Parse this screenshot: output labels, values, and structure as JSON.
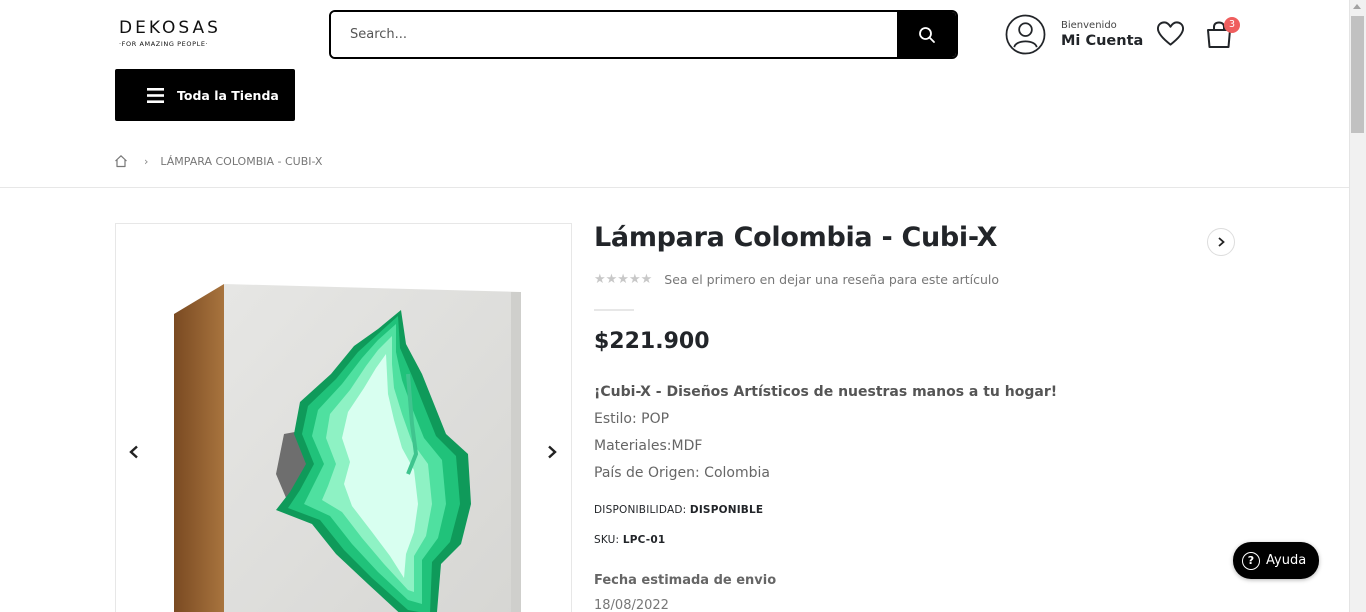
{
  "header": {
    "logo_main": "DEKOSAS",
    "logo_sub": "·FOR AMAZING PEOPLE·",
    "search_placeholder": "Search...",
    "account_greeting": "Bienvenido",
    "account_label": "Mi Cuenta",
    "cart_count": "3",
    "store_button": "Toda la Tienda"
  },
  "breadcrumb": {
    "current": "LÁMPARA COLOMBIA - CUBI-X"
  },
  "product": {
    "title": "Lámpara Colombia - Cubi-X",
    "rating_text": "Sea el primero en dejar una reseña para este artículo",
    "rating_stars": "★★★★★",
    "price": "$221.900",
    "description_headline": "¡Cubi-X - Diseños Artísticos de nuestras manos a tu hogar!",
    "style_line": "Estilo: POP",
    "materials_line": "Materiales:MDF",
    "origin_line": "País de Origen: Colombia",
    "availability_label": "DISPONIBILIDAD:",
    "availability_value": "DISPONIBLE",
    "sku_label": "SKU:",
    "sku_value": "LPC-01",
    "ship_label": "Fecha estimada de envio",
    "ship_date": "18/08/2022"
  },
  "help": {
    "label": "Ayuda"
  },
  "colors": {
    "accent": "#000000",
    "badge": "#ef5e5e",
    "text_dark": "#222529",
    "text_muted": "#777777"
  },
  "icons": {
    "search": "search-icon",
    "account": "user-circle-icon",
    "wishlist": "heart-icon",
    "cart": "shopping-bag-icon",
    "menu": "hamburger-icon",
    "home": "home-icon",
    "gallery_prev": "chevron-left-icon",
    "gallery_next": "chevron-right-icon",
    "next_product": "chevron-right-icon",
    "help": "question-circle-icon"
  }
}
